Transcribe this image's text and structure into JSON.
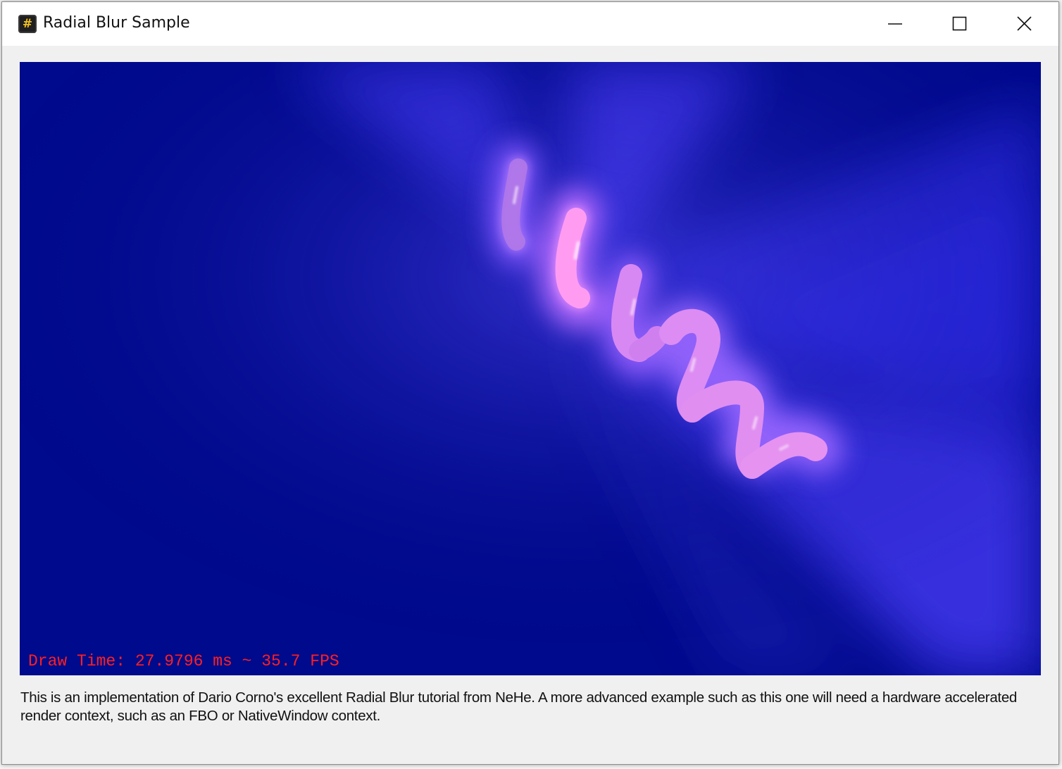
{
  "window": {
    "title": "Radial Blur Sample",
    "icon": "app-icon"
  },
  "caption_buttons": {
    "minimize": "minimize-icon",
    "maximize": "maximize-icon",
    "close": "close-icon"
  },
  "render": {
    "background_color": "#000a8c",
    "glow_color": "#4a3cff",
    "spring_color": "#ff8cf0",
    "fps_text": "Draw Time: 27.9796 ms ~ 35.7 FPS",
    "fps_color": "#ff2020"
  },
  "description": "This is an implementation of Dario Corno's excellent Radial Blur tutorial from NeHe. A more advanced example such as this one will need a hardware accelerated render context, such as an FBO or NativeWindow context."
}
